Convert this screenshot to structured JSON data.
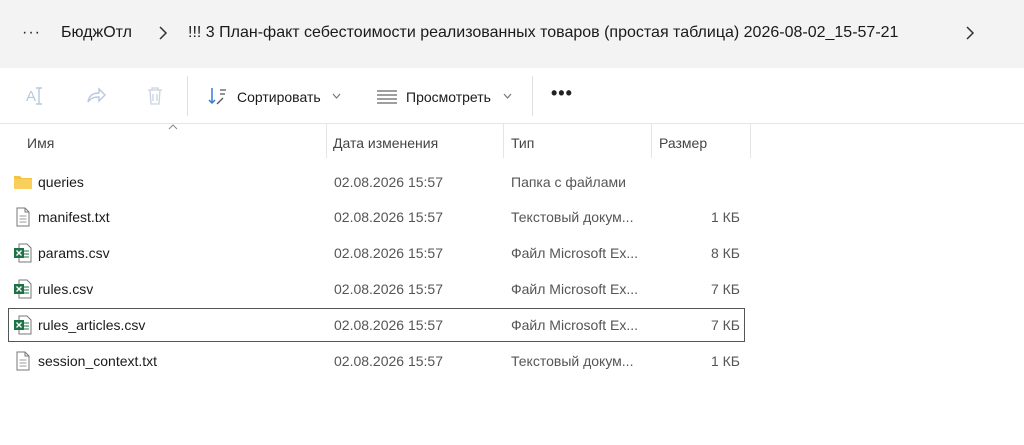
{
  "breadcrumb": {
    "more": "···",
    "items": [
      "БюджОтл",
      "!!! 3 План-факт себестоимости реализованных товаров (простая таблица) 2026-08-02_15-57-21"
    ]
  },
  "toolbar": {
    "sort_label": "Сортировать",
    "view_label": "Просмотреть",
    "more_label": "•••"
  },
  "columns": {
    "name": "Имя",
    "date": "Дата изменения",
    "type": "Тип",
    "size": "Размер"
  },
  "files": [
    {
      "name": "queries",
      "date": "02.08.2026 15:57",
      "type": "Папка с файлами",
      "size": "",
      "icon": "folder-icon"
    },
    {
      "name": "manifest.txt",
      "date": "02.08.2026 15:57",
      "type": "Текстовый докум...",
      "size": "1 КБ",
      "icon": "text-file-icon"
    },
    {
      "name": "params.csv",
      "date": "02.08.2026 15:57",
      "type": "Файл Microsoft Ex...",
      "size": "8 КБ",
      "icon": "excel-file-icon"
    },
    {
      "name": "rules.csv",
      "date": "02.08.2026 15:57",
      "type": "Файл Microsoft Ex...",
      "size": "7 КБ",
      "icon": "excel-file-icon"
    },
    {
      "name": "rules_articles.csv",
      "date": "02.08.2026 15:57",
      "type": "Файл Microsoft Ex...",
      "size": "7 КБ",
      "icon": "excel-file-icon",
      "selected": true
    },
    {
      "name": "session_context.txt",
      "date": "02.08.2026 15:57",
      "type": "Текстовый докум...",
      "size": "1 КБ",
      "icon": "text-file-icon"
    }
  ],
  "colors": {
    "breadcrumb_bg": "#f3f3f3",
    "folder": "#f6c445",
    "excel": "#1e7145",
    "disabled_icon": "#b7c9e2"
  }
}
